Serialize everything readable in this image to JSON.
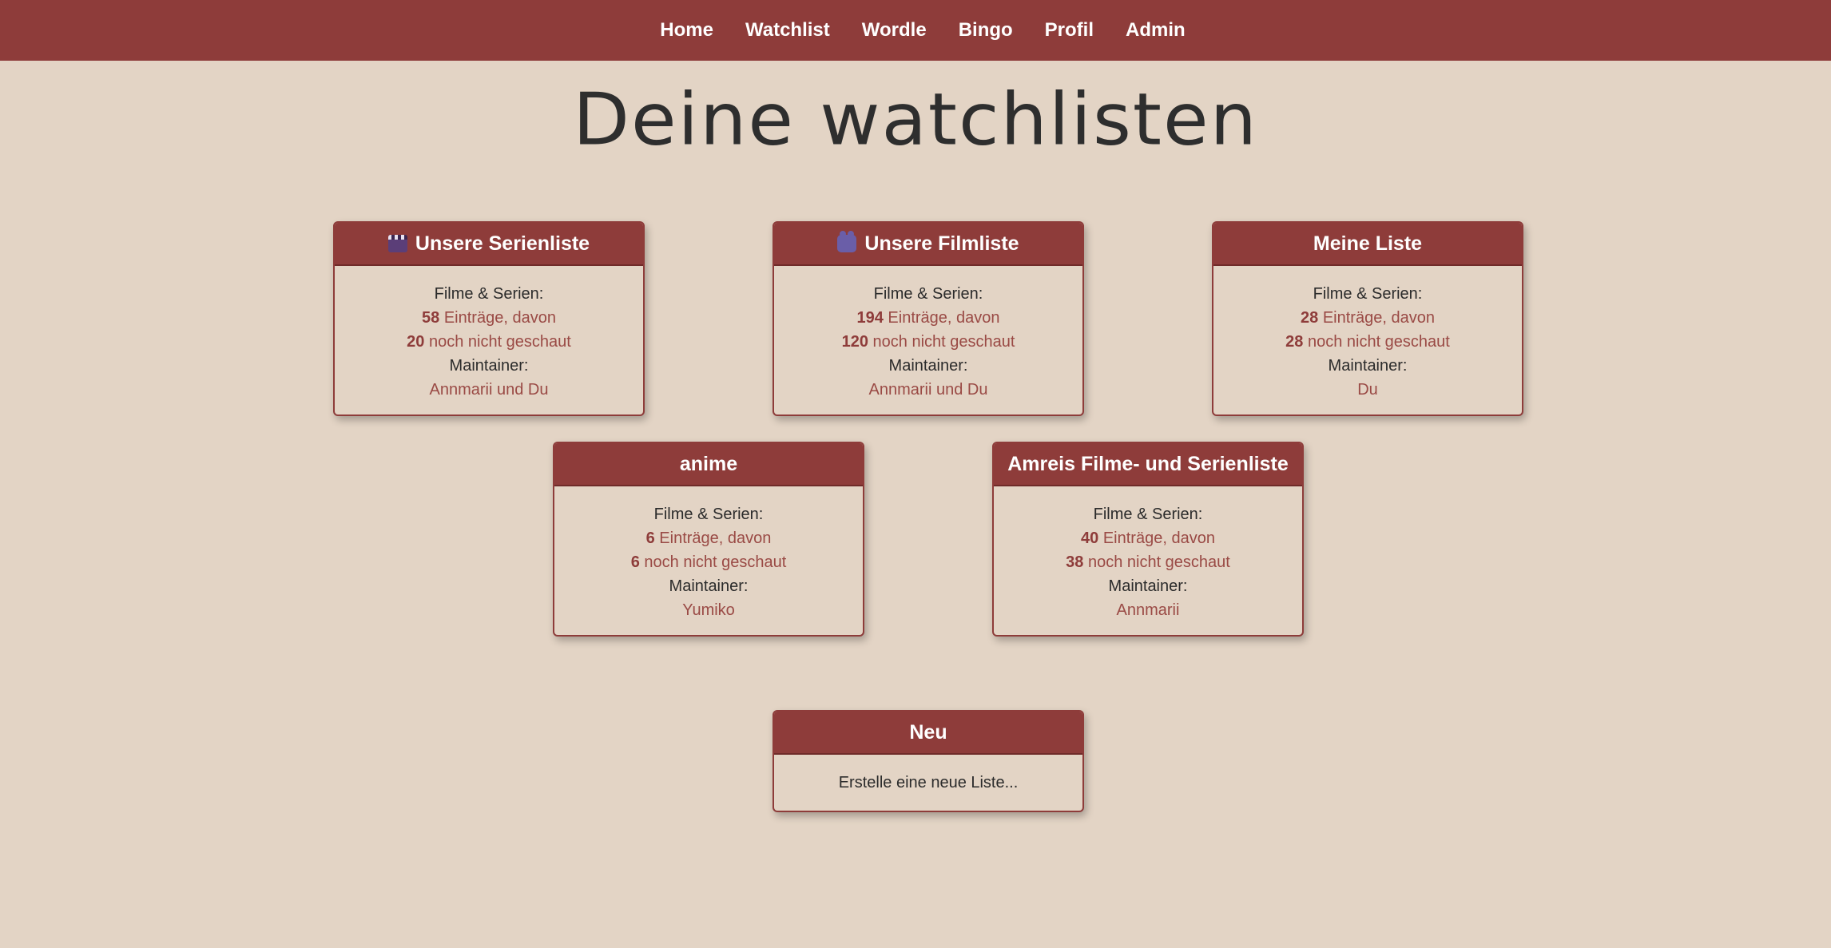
{
  "nav": {
    "items": [
      "Home",
      "Watchlist",
      "Wordle",
      "Bingo",
      "Profil",
      "Admin"
    ]
  },
  "page": {
    "title": "Deine watchlisten"
  },
  "lists": [
    {
      "title": "Unsere Serienliste",
      "icon": "clapperboard-icon",
      "label_items": "Filme & Serien:",
      "entries": "58",
      "entries_suffix": "Einträge, davon",
      "unwatched": "20",
      "unwatched_suffix": "noch nicht geschaut",
      "label_maintainer": "Maintainer:",
      "maintainer": "Annmarii und Du"
    },
    {
      "title": "Unsere Filmliste",
      "icon": "movie-camera-icon",
      "label_items": "Filme & Serien:",
      "entries": "194",
      "entries_suffix": "Einträge, davon",
      "unwatched": "120",
      "unwatched_suffix": "noch nicht geschaut",
      "label_maintainer": "Maintainer:",
      "maintainer": "Annmarii und Du"
    },
    {
      "title": "Meine Liste",
      "label_items": "Filme & Serien:",
      "entries": "28",
      "entries_suffix": "Einträge, davon",
      "unwatched": "28",
      "unwatched_suffix": "noch nicht geschaut",
      "label_maintainer": "Maintainer:",
      "maintainer": "Du"
    },
    {
      "title": "anime",
      "label_items": "Filme & Serien:",
      "entries": "6",
      "entries_suffix": "Einträge, davon",
      "unwatched": "6",
      "unwatched_suffix": "noch nicht geschaut",
      "label_maintainer": "Maintainer:",
      "maintainer": "Yumiko"
    },
    {
      "title": "Amreis Filme- und Serienliste",
      "label_items": "Filme & Serien:",
      "entries": "40",
      "entries_suffix": "Einträge, davon",
      "unwatched": "38",
      "unwatched_suffix": "noch nicht geschaut",
      "label_maintainer": "Maintainer:",
      "maintainer": "Annmarii"
    }
  ],
  "new_list": {
    "title": "Neu",
    "text": "Erstelle eine neue Liste..."
  },
  "colors": {
    "header": "#8e3c3a",
    "background": "#e3d4c5",
    "accent_text": "#9a4a45"
  }
}
